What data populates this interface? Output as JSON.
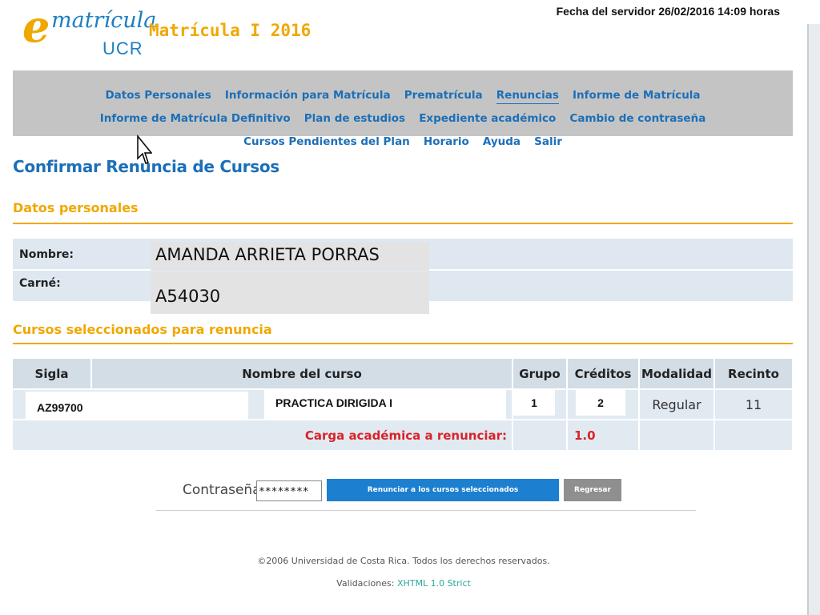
{
  "header": {
    "server_date": "Fecha del servidor 26/02/2016 14:09 horas",
    "logo_e": "e",
    "logo_word": "matrícula",
    "logo_ucr": "UCR",
    "app_title": "Matrícula I 2016"
  },
  "nav": {
    "items": [
      {
        "label": "Datos Personales"
      },
      {
        "label": "Información para Matrícula"
      },
      {
        "label": "Prematrícula"
      },
      {
        "label": "Renuncias"
      },
      {
        "label": "Informe de Matrícula"
      },
      {
        "label": "Informe de Matrícula Definitivo"
      },
      {
        "label": "Plan de estudios"
      },
      {
        "label": "Expediente académico"
      },
      {
        "label": "Cambio de contraseña"
      },
      {
        "label": "Cursos Pendientes del Plan"
      },
      {
        "label": "Horario"
      },
      {
        "label": "Ayuda"
      },
      {
        "label": "Salir"
      }
    ],
    "active": "Renuncias"
  },
  "page": {
    "title": "Confirmar Renuncia de Cursos"
  },
  "personal": {
    "section_title": "Datos personales",
    "name_label": "Nombre:",
    "name_value": "AMANDA ARRIETA PORRAS",
    "carne_label": "Carné:",
    "carne_value": "A54030"
  },
  "courses": {
    "section_title": "Cursos seleccionados para renuncia",
    "headers": [
      "Sigla",
      "Nombre del curso",
      "Grupo",
      "Créditos",
      "Modalidad",
      "Recinto"
    ],
    "rows": [
      {
        "sigla": "AZ99700",
        "nombre": "PRACTICA DIRIGIDA I",
        "grupo": "1",
        "creditos": "2",
        "modalidad": "Regular",
        "recinto": "11"
      }
    ],
    "total_label": "Carga académica a renunciar:",
    "total_value": "1.0"
  },
  "form": {
    "password_label": "Contraseña:",
    "password_value": "********",
    "submit_label": "Renunciar a los cursos seleccionados",
    "back_label": "Regresar"
  },
  "footer": {
    "copyright": "©2006 Universidad de Costa Rica. Todos los derechos reservados.",
    "validations_label": "Validaciones:",
    "validations_link": "XHTML 1.0 Strict"
  },
  "colors": {
    "brand_blue": "#1c6fb8",
    "brand_orange": "#f0a800",
    "alert_red": "#d9232a"
  }
}
